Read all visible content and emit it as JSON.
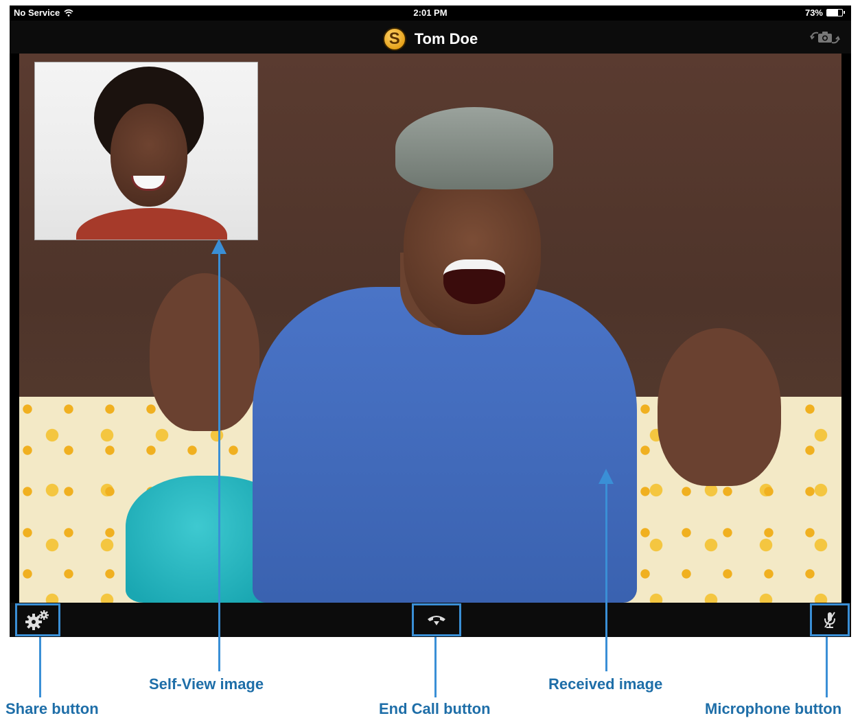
{
  "status_bar": {
    "carrier": "No Service",
    "time": "2:01 PM",
    "battery_percent": "73%",
    "battery_level": 0.73
  },
  "nav_bar": {
    "logo_letter": "S",
    "title": "Tom Doe",
    "camera_switch_icon": "camera-switch-icon"
  },
  "video": {
    "received_alt": "Received image",
    "self_view_alt": "Self-View image"
  },
  "toolbar": {
    "share_icon": "gears-icon",
    "end_call_icon": "hang-up-icon",
    "microphone_icon": "microphone-muted-icon"
  },
  "callouts": {
    "self_view": "Self-View image",
    "received": "Received image",
    "share": "Share button",
    "end_call": "End Call button",
    "microphone": "Microphone button"
  },
  "colors": {
    "callout_blue": "#3a8fd6",
    "callout_text": "#1e6ea8",
    "bar_bg": "#0c0c0c"
  }
}
